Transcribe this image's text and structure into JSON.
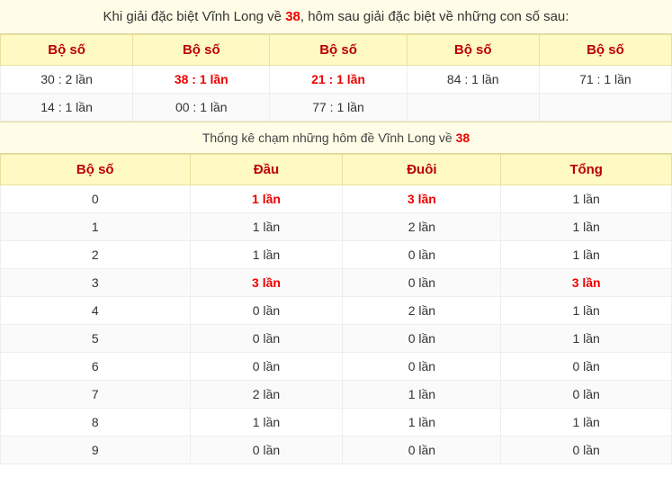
{
  "header": {
    "text_before": "Khi giải đặc biệt Vĩnh Long về ",
    "number": "38",
    "text_after": ", hôm sau giải đặc biệt về những con số sau:"
  },
  "bo_so_table": {
    "column_header": "Bộ số",
    "rows": [
      [
        "30 : 2 lần",
        "38 : 1 lần",
        "21 : 1 lần",
        "84 : 1 lần",
        "71 : 1 lần"
      ],
      [
        "14 : 1 lần",
        "00 : 1 lần",
        "77 : 1 lần",
        "",
        ""
      ]
    ],
    "red_cells": [
      "38 : 1 lần",
      "21 : 1 lần"
    ]
  },
  "section_divider": {
    "text_before": "Thống kê chạm những hôm đề Vĩnh Long về ",
    "number": "38"
  },
  "stats_table": {
    "headers": [
      "Bộ số",
      "Đầu",
      "Đuôi",
      "Tổng"
    ],
    "rows": [
      {
        "bo_so": "0",
        "dau": "1 lần",
        "duoi": "3 lần",
        "tong": "1 lần",
        "dau_red": true,
        "duoi_red": true,
        "tong_red": false
      },
      {
        "bo_so": "1",
        "dau": "1 lần",
        "duoi": "2 lần",
        "tong": "1 lần",
        "dau_red": false,
        "duoi_red": false,
        "tong_red": false
      },
      {
        "bo_so": "2",
        "dau": "1 lần",
        "duoi": "0 lần",
        "tong": "1 lần",
        "dau_red": false,
        "duoi_red": false,
        "tong_red": false
      },
      {
        "bo_so": "3",
        "dau": "3 lần",
        "duoi": "0 lần",
        "tong": "3 lần",
        "dau_red": true,
        "duoi_red": false,
        "tong_red": true
      },
      {
        "bo_so": "4",
        "dau": "0 lần",
        "duoi": "2 lần",
        "tong": "1 lần",
        "dau_red": false,
        "duoi_red": false,
        "tong_red": false
      },
      {
        "bo_so": "5",
        "dau": "0 lần",
        "duoi": "0 lần",
        "tong": "1 lần",
        "dau_red": false,
        "duoi_red": false,
        "tong_red": false
      },
      {
        "bo_so": "6",
        "dau": "0 lần",
        "duoi": "0 lần",
        "tong": "0 lần",
        "dau_red": false,
        "duoi_red": false,
        "tong_red": false
      },
      {
        "bo_so": "7",
        "dau": "2 lần",
        "duoi": "1 lần",
        "tong": "0 lần",
        "dau_red": false,
        "duoi_red": false,
        "tong_red": false
      },
      {
        "bo_so": "8",
        "dau": "1 lần",
        "duoi": "1 lần",
        "tong": "1 lần",
        "dau_red": false,
        "duoi_red": false,
        "tong_red": false
      },
      {
        "bo_so": "9",
        "dau": "0 lần",
        "duoi": "0 lần",
        "tong": "0 lần",
        "dau_red": false,
        "duoi_red": false,
        "tong_red": false
      }
    ]
  }
}
